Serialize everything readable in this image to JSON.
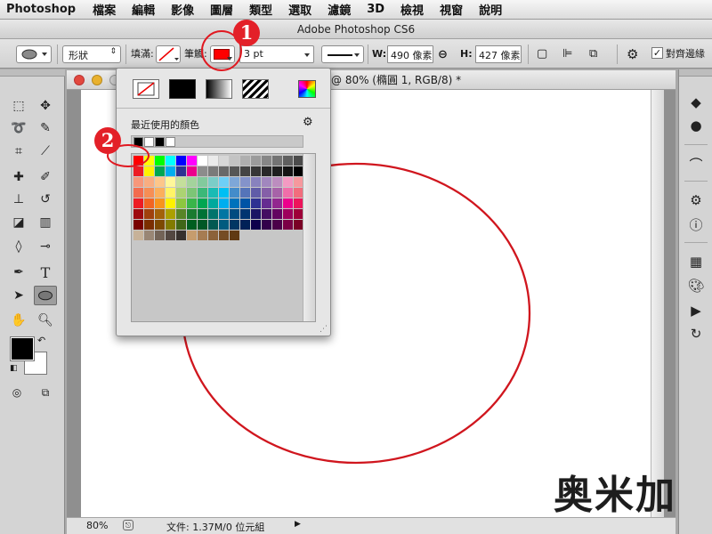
{
  "menubar": {
    "app_name": "Photoshop",
    "items": [
      "檔案",
      "編輯",
      "影像",
      "圖層",
      "類型",
      "選取",
      "濾鏡",
      "3D",
      "檢視",
      "視窗",
      "說明"
    ]
  },
  "window_title": "Adobe Photoshop CS6",
  "options_bar": {
    "mode_value": "形狀",
    "fill_label": "填滿:",
    "stroke_label": "筆觸:",
    "stroke_width": "3 pt",
    "w_label": "W:",
    "w_value": "490 像素",
    "h_label": "H:",
    "h_value": "427 像素",
    "align_edges_label": "對齊邊緣",
    "align_edges_checked": true,
    "stroke_color": "#ff0000"
  },
  "document": {
    "title": "@ 80% (橢圓 1, RGB/8) *",
    "zoom": "80%",
    "file_info": "文件: 1.37M/0 位元組"
  },
  "color_popup": {
    "recent_label": "最近使用的顏色",
    "recent_colors": [
      "#000000",
      "#ffffff",
      "#000000",
      "#ffffff"
    ],
    "fill_types": [
      "no-color",
      "solid-color",
      "gradient",
      "pattern"
    ],
    "swatch_rows": [
      [
        "#ff0000",
        "#ffff00",
        "#00ff00",
        "#00ffff",
        "#0000ff",
        "#ff00ff",
        "#ffffff",
        "#ebebeb",
        "#d7d7d7",
        "#c3c3c3",
        "#afafaf",
        "#9b9b9b",
        "#878787",
        "#737373",
        "#5f5f5f",
        "#4b4b4b"
      ],
      [
        "#ed1c24",
        "#fff200",
        "#00a651",
        "#00aeef",
        "#2e3192",
        "#ec008c",
        "#8c8c8c",
        "#7a7a7a",
        "#686868",
        "#565656",
        "#444444",
        "#363636",
        "#282828",
        "#1e1e1e",
        "#141414",
        "#000000"
      ],
      [
        "#f7977a",
        "#f9ad81",
        "#fdc68a",
        "#fff79a",
        "#c4df9b",
        "#a3d39c",
        "#82ca9d",
        "#7bcdc8",
        "#6ecff6",
        "#7ea7d8",
        "#8493ca",
        "#8882be",
        "#a187be",
        "#bc8dbf",
        "#f49ac2",
        "#f6989d"
      ],
      [
        "#f26c4f",
        "#f68e55",
        "#fbaf5c",
        "#fff467",
        "#acd372",
        "#7cc576",
        "#3bb878",
        "#1abbb4",
        "#00bff3",
        "#438cca",
        "#5574b9",
        "#605ca8",
        "#855fa8",
        "#a763a8",
        "#f06ea9",
        "#f26d7d"
      ],
      [
        "#ed1c24",
        "#f26522",
        "#f7941d",
        "#fff200",
        "#8dc73f",
        "#39b54a",
        "#00a651",
        "#00a99d",
        "#00aeef",
        "#0072bc",
        "#0054a6",
        "#2e3192",
        "#662d91",
        "#92278f",
        "#ec008c",
        "#ed145b"
      ],
      [
        "#9e0b0f",
        "#a0410d",
        "#a3620a",
        "#aba000",
        "#598527",
        "#1a7b30",
        "#007236",
        "#00746b",
        "#0076a3",
        "#004b80",
        "#003471",
        "#1b1464",
        "#440e62",
        "#630460",
        "#9e005d",
        "#9e0039"
      ],
      [
        "#790000",
        "#7b2e00",
        "#7d4900",
        "#827b00",
        "#406618",
        "#005e20",
        "#005826",
        "#005952",
        "#005b7f",
        "#003663",
        "#002157",
        "#0d004c",
        "#32004b",
        "#4b0049",
        "#7b0046",
        "#7a0026"
      ],
      [
        "#c7b299",
        "#998675",
        "#736357",
        "#534741",
        "#37302d",
        "#c69c6d",
        "#a67c52",
        "#8c6239",
        "#754c24",
        "#603913"
      ]
    ]
  },
  "annotations": {
    "badge_1": "1",
    "badge_2": "2"
  },
  "ellipse": {
    "stroke_color": "#d0161e"
  },
  "watermark": "奥米加"
}
